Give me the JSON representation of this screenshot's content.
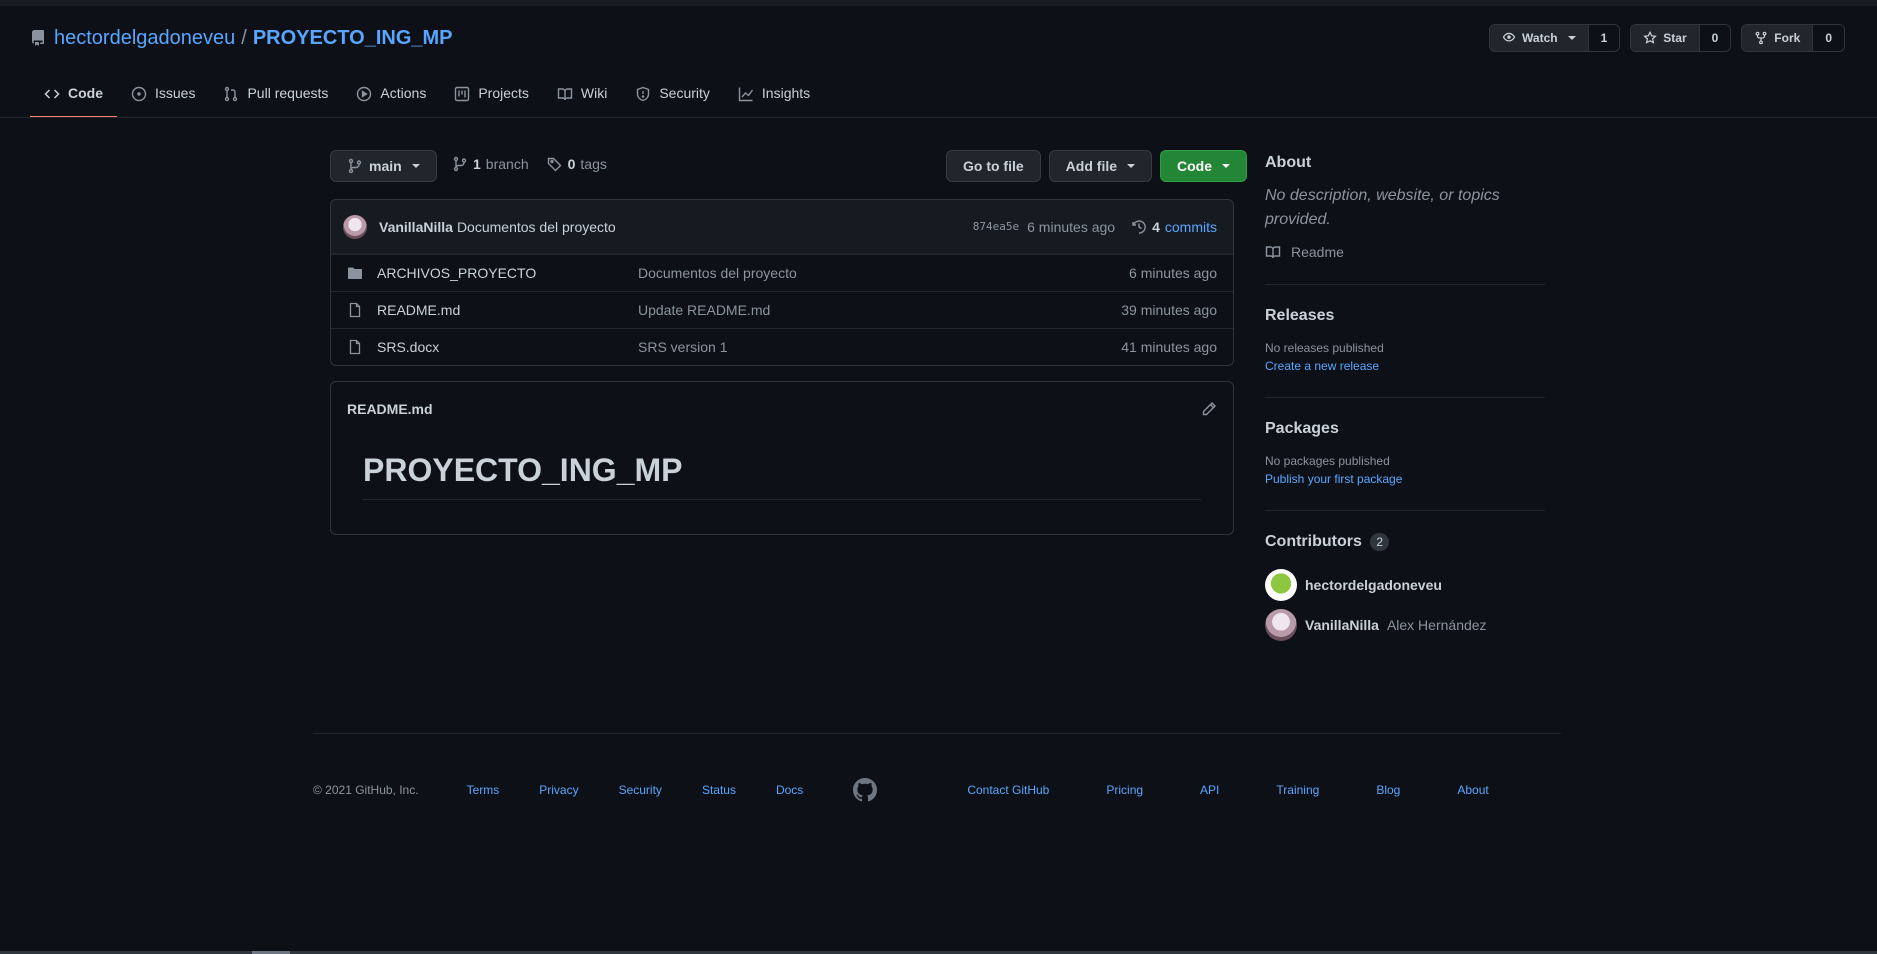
{
  "repo": {
    "owner": "hectordelgadoneveu",
    "separator": "/",
    "name": "PROYECTO_ING_MP"
  },
  "header_actions": {
    "watch_label": "Watch",
    "watch_count": "1",
    "star_label": "Star",
    "star_count": "0",
    "fork_label": "Fork",
    "fork_count": "0"
  },
  "tabs": [
    {
      "label": "Code",
      "icon": "code-icon",
      "active": true
    },
    {
      "label": "Issues",
      "icon": "issue-icon"
    },
    {
      "label": "Pull requests",
      "icon": "pull-request-icon"
    },
    {
      "label": "Actions",
      "icon": "play-icon"
    },
    {
      "label": "Projects",
      "icon": "project-icon"
    },
    {
      "label": "Wiki",
      "icon": "book-icon"
    },
    {
      "label": "Security",
      "icon": "shield-icon"
    },
    {
      "label": "Insights",
      "icon": "graph-icon"
    }
  ],
  "toolbar": {
    "branch_name": "main",
    "branch_count": "1",
    "branch_word": "branch",
    "tag_count": "0",
    "tag_word": "tags",
    "go_to_file": "Go to file",
    "add_file": "Add file",
    "code": "Code"
  },
  "latest_commit": {
    "author": "VanillaNilla",
    "message": "Documentos del proyecto",
    "sha": "874ea5e",
    "age": "6 minutes ago",
    "commit_count": "4",
    "commit_word": "commits"
  },
  "files": [
    {
      "type": "folder",
      "name": "ARCHIVOS_PROYECTO",
      "message": "Documentos del proyecto",
      "age": "6 minutes ago"
    },
    {
      "type": "file",
      "name": "README.md",
      "message": "Update README.md",
      "age": "39 minutes ago"
    },
    {
      "type": "file",
      "name": "SRS.docx",
      "message": "SRS version 1",
      "age": "41 minutes ago"
    }
  ],
  "readme": {
    "filename": "README.md",
    "heading": "PROYECTO_ING_MP"
  },
  "sidebar": {
    "about_title": "About",
    "about_desc": "No description, website, or topics provided.",
    "readme_link": "Readme",
    "releases_title": "Releases",
    "releases_none": "No releases published",
    "releases_link": "Create a new release",
    "packages_title": "Packages",
    "packages_none": "No packages published",
    "packages_link": "Publish your first package",
    "contributors_title": "Contributors",
    "contributors_count": "2",
    "contributors": [
      {
        "login": "hectordelgadoneveu",
        "name": ""
      },
      {
        "login": "VanillaNilla",
        "name": "Alex Hernández"
      }
    ]
  },
  "footer": {
    "copyright": "© 2021 GitHub, Inc.",
    "left_links": [
      "Terms",
      "Privacy",
      "Security",
      "Status",
      "Docs"
    ],
    "right_links": [
      "Contact GitHub",
      "Pricing",
      "API",
      "Training",
      "Blog",
      "About"
    ]
  }
}
